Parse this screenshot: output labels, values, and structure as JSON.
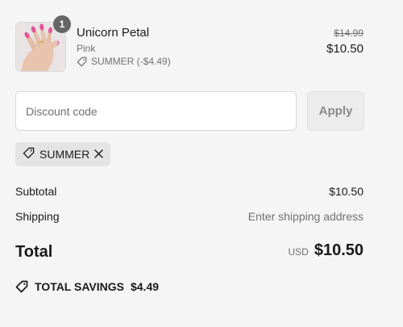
{
  "product": {
    "quantity": "1",
    "name": "Unicorn Petal",
    "variant": "Pink",
    "discount_line": "SUMMER (-$4.49)",
    "price_original": "$14.99",
    "price_current": "$10.50"
  },
  "discount": {
    "placeholder": "Discount code",
    "apply_label": "Apply",
    "applied_code": "SUMMER"
  },
  "summary": {
    "subtotal_label": "Subtotal",
    "subtotal_value": "$10.50",
    "shipping_label": "Shipping",
    "shipping_value": "Enter shipping address",
    "total_label": "Total",
    "currency": "USD",
    "total_value": "$10.50",
    "savings_label": "TOTAL SAVINGS",
    "savings_value": "$4.49"
  },
  "icons": {
    "product_image": "pink-nails-hand-image",
    "discount": "tag-icon",
    "remove": "close-icon"
  },
  "colors": {
    "background": "#f5f5f5",
    "badge": "#666666",
    "muted_text": "#707070",
    "tag_background": "#e4e4e4"
  }
}
